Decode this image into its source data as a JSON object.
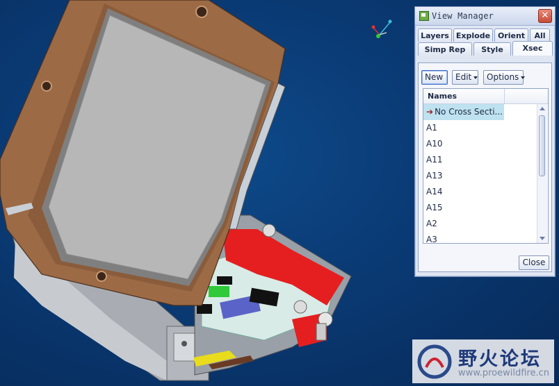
{
  "dialog": {
    "title": "View Manager",
    "tabs_row1": [
      "Layers",
      "Explode",
      "Orient",
      "All"
    ],
    "tabs_row2": [
      "Simp Rep",
      "Style",
      "Xsec"
    ],
    "active_tab": "Xsec",
    "toolbar": {
      "new_label": "New",
      "edit_label": "Edit",
      "options_label": "Options"
    },
    "list": {
      "header": "Names",
      "items": [
        "No Cross Secti...",
        "A1",
        "A10",
        "A11",
        "A13",
        "A14",
        "A15",
        "A2",
        "A3"
      ],
      "selected": "No Cross Secti..."
    },
    "close_label": "Close"
  },
  "watermark": {
    "text": "野火论坛",
    "url": "www.proewildfire.cn"
  },
  "colors": {
    "background": "#0a3a74",
    "housing": "#9c6a45",
    "screen": "#b7b7b7",
    "pcb": "#d8ebe6",
    "red_part": "#e51f1f",
    "dialog_bg": "#dfe6f2"
  }
}
